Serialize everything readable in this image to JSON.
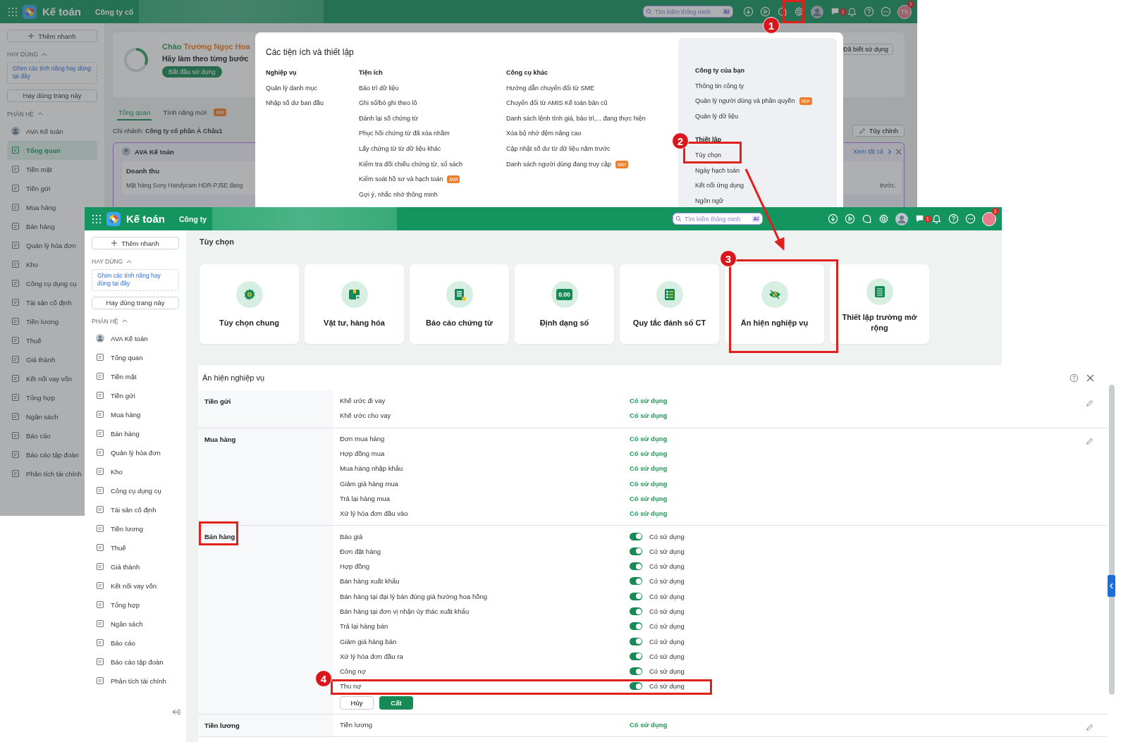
{
  "background_window": {
    "header": {
      "app_name": "Kế toán",
      "company": "Công ty cổ",
      "search": {
        "placeholder": "Tìm kiếm thông minh"
      },
      "ai_badge": "AI",
      "chat_badge": "1",
      "avatar_initials": "Th",
      "avatar_badge": "1"
    },
    "sidebar": {
      "quick_add": "Thêm nhanh",
      "favorites_heading": "HAY DÙNG",
      "favorites_hint": "Ghim các tính năng hay dùng tại đây",
      "favorite_page": "Hay dùng trang này",
      "modules_heading": "PHÂN HỆ",
      "items": [
        {
          "label": "AVA Kế toán",
          "selected": false
        },
        {
          "label": "Tổng quan",
          "selected": true
        },
        {
          "label": "Tiền mặt",
          "selected": false
        },
        {
          "label": "Tiền gửi",
          "selected": false
        },
        {
          "label": "Mua hàng",
          "selected": false
        },
        {
          "label": "Bán hàng",
          "selected": false
        },
        {
          "label": "Quản lý hóa đơn",
          "selected": false
        },
        {
          "label": "Kho",
          "selected": false
        },
        {
          "label": "Công cụ dụng cụ",
          "selected": false
        },
        {
          "label": "Tài sản cố định",
          "selected": false
        },
        {
          "label": "Tiền lương",
          "selected": false
        },
        {
          "label": "Thuế",
          "selected": false
        },
        {
          "label": "Giá thành",
          "selected": false
        },
        {
          "label": "Kết nối vay vốn",
          "selected": false
        },
        {
          "label": "Tổng hợp",
          "selected": false
        },
        {
          "label": "Ngân sách",
          "selected": false
        },
        {
          "label": "Báo cáo",
          "selected": false
        },
        {
          "label": "Báo cáo tập đoàn",
          "selected": false
        },
        {
          "label": "Phân tích tài chính",
          "selected": false
        }
      ]
    },
    "content": {
      "greeting": "Chào",
      "greeting_name": "Trường Ngọc Hoa",
      "instruction": "Hãy làm theo từng bước",
      "start_button": "Bắt đầu sử dụng",
      "known_button": "Đã biết sử dụng",
      "tabs": [
        {
          "label": "Tổng quan",
          "selected": true
        },
        {
          "label": "Tính năng mới",
          "selected": false,
          "badge": "Mới"
        }
      ],
      "branch": "Chi nhánh: **Công ty cổ phần Á Châu1**",
      "customize_button": "Tùy chỉnh",
      "card_title": "AVA Kế toán",
      "view_all_link": "Xem tất cả",
      "card_heading": "Doanh thu",
      "card_text": "Mặt hàng Sony Handycam HDR-PJ5E đang",
      "trailing_text": "trước."
    }
  },
  "utilities_popup": {
    "title": "Các tiện ích và thiết lập",
    "columns": [
      {
        "heading": "Nghiệp vụ",
        "items": [
          {
            "label": "Quản lý danh mục"
          },
          {
            "label": "Nhập số dư ban đầu"
          }
        ]
      },
      {
        "heading": "Tiện ích",
        "items": [
          {
            "label": "Bảo trì dữ liệu"
          },
          {
            "label": "Ghi sổ/bỏ ghi theo lô"
          },
          {
            "label": "Đánh lại số chứng từ"
          },
          {
            "label": "Phục hồi chứng từ đã xóa nhầm"
          },
          {
            "label": "Lấy chứng từ từ dữ liệu khác"
          },
          {
            "label": "Kiểm tra đối chiếu chứng từ, sổ sách"
          },
          {
            "label": "Kiểm soát hồ sơ và hạch toán",
            "badge": "Mới"
          },
          {
            "label": "Gợi ý, nhắc nhở thông minh"
          }
        ]
      },
      {
        "heading": "Công cụ khác",
        "items": [
          {
            "label": "Hướng dẫn chuyển đổi từ SME"
          },
          {
            "label": "Chuyển đổi từ AMIS Kế toán bản cũ"
          },
          {
            "label": "Danh sách lệnh tính giá, bảo trì,... đang thực hiện"
          },
          {
            "label": "Xóa bộ nhớ đệm nâng cao"
          },
          {
            "label": "Cập nhật số dư từ dữ liệu năm trước"
          },
          {
            "label": "Danh sách người dùng đang truy cập",
            "badge": "Mới"
          }
        ]
      }
    ],
    "side_groups": [
      {
        "heading": "Công ty của bạn",
        "items": [
          {
            "label": "Thông tin công ty"
          },
          {
            "label": "Quản lý người dùng và phân quyền",
            "badge": "Mới"
          },
          {
            "label": "Quản lý dữ liệu"
          }
        ]
      },
      {
        "heading": "Thiết lập",
        "items": [
          {
            "label": "Tùy chọn"
          },
          {
            "label": "Ngày hạch toán"
          },
          {
            "label": "Kết nối ứng dụng"
          },
          {
            "label": "Ngôn ngữ"
          }
        ]
      }
    ]
  },
  "foreground_window": {
    "header": {
      "app_name": "Kế toán",
      "company": "Công ty",
      "search": {
        "placeholder": "Tìm kiếm thông minh"
      },
      "ai_badge": "AI",
      "chat_badge": "1",
      "avatar_badge": "1"
    },
    "sidebar": {
      "quick_add": "Thêm nhanh",
      "favorites_heading": "HAY DÙNG",
      "favorites_hint": "Ghim các tính năng hay dùng tại đây",
      "favorite_page": "Hay dùng trang này",
      "modules_heading": "PHÂN HỆ",
      "items": [
        {
          "label": "AVA Kế toán",
          "selected": false
        },
        {
          "label": "Tổng quan",
          "selected": false
        },
        {
          "label": "Tiền mặt",
          "selected": false
        },
        {
          "label": "Tiền gửi",
          "selected": false
        },
        {
          "label": "Mua hàng",
          "selected": false
        },
        {
          "label": "Bán hàng",
          "selected": false
        },
        {
          "label": "Quản lý hóa đơn",
          "selected": false
        },
        {
          "label": "Kho",
          "selected": false
        },
        {
          "label": "Công cụ dụng cụ",
          "selected": false
        },
        {
          "label": "Tài sản cố định",
          "selected": false
        },
        {
          "label": "Tiền lương",
          "selected": false
        },
        {
          "label": "Thuế",
          "selected": false
        },
        {
          "label": "Giá thành",
          "selected": false
        },
        {
          "label": "Kết nối vay vốn",
          "selected": false
        },
        {
          "label": "Tổng hợp",
          "selected": false
        },
        {
          "label": "Ngân sách",
          "selected": false
        },
        {
          "label": "Báo cáo",
          "selected": false
        },
        {
          "label": "Báo cáo tập đoàn",
          "selected": false
        },
        {
          "label": "Phân tích tài chính",
          "selected": false
        }
      ]
    },
    "page_title": "Tùy chọn",
    "cards": [
      {
        "label": "Tùy chọn chung"
      },
      {
        "label": "Vật tư, hàng hóa"
      },
      {
        "label": "Báo cáo chứng từ"
      },
      {
        "label": "Định dạng số",
        "icon_text": "0.00"
      },
      {
        "label": "Quy tắc đánh số CT"
      },
      {
        "label": "Ẩn hiện nghiệp vụ"
      },
      {
        "label": "Thiết lập trường mở rộng"
      }
    ],
    "panel": {
      "title": "Ẩn hiện nghiệp vụ",
      "cancel_button": "Hủy",
      "save_button": "Cất",
      "sections": [
        {
          "name": "Tiền gửi",
          "editing": false,
          "rows": [
            {
              "label": "Khế ước đi vay",
              "status": "Có sử dụng"
            },
            {
              "label": "Khế ước cho vay",
              "status": "Có sử dụng"
            }
          ]
        },
        {
          "name": "Mua hàng",
          "editing": false,
          "rows": [
            {
              "label": "Đơn mua hàng",
              "status": "Có sử dụng"
            },
            {
              "label": "Hợp đồng mua",
              "status": "Có sử dụng"
            },
            {
              "label": "Mua hàng nhập khẩu",
              "status": "Có sử dụng"
            },
            {
              "label": "Giảm giá hàng mua",
              "status": "Có sử dụng"
            },
            {
              "label": "Trả lại hàng mua",
              "status": "Có sử dụng"
            },
            {
              "label": "Xử lý hóa đơn đầu vào",
              "status": "Có sử dụng"
            }
          ]
        },
        {
          "name": "Bán hàng",
          "editing": true,
          "rows": [
            {
              "label": "Báo giá",
              "status": "Có sử dụng",
              "on": true
            },
            {
              "label": "Đơn đặt hàng",
              "status": "Có sử dụng",
              "on": true
            },
            {
              "label": "Hợp đồng",
              "status": "Có sử dụng",
              "on": true
            },
            {
              "label": "Bán hàng xuất khẩu",
              "status": "Có sử dụng",
              "on": true
            },
            {
              "label": "Bán hàng tại đại lý bán đúng giá hưởng hoa hồng",
              "status": "Có sử dụng",
              "on": true
            },
            {
              "label": "Bán hàng tại đơn vị nhận ủy thác xuất khẩu",
              "status": "Có sử dụng",
              "on": true
            },
            {
              "label": "Trả lại hàng bán",
              "status": "Có sử dụng",
              "on": true
            },
            {
              "label": "Giảm giá hàng bán",
              "status": "Có sử dụng",
              "on": true
            },
            {
              "label": "Xử lý hóa đơn đầu ra",
              "status": "Có sử dụng",
              "on": true
            },
            {
              "label": "Công nợ",
              "status": "Có sử dụng",
              "on": true
            },
            {
              "label": "Thu nợ",
              "status": "Có sử dụng",
              "on": true
            }
          ]
        },
        {
          "name": "Tiền lương",
          "editing": false,
          "rows": [
            {
              "label": "Tiền lương",
              "status": "Có sử dụng"
            }
          ]
        }
      ]
    }
  },
  "annotations": [
    {
      "label": "1"
    },
    {
      "label": "2"
    },
    {
      "label": "3"
    },
    {
      "label": "4"
    }
  ]
}
